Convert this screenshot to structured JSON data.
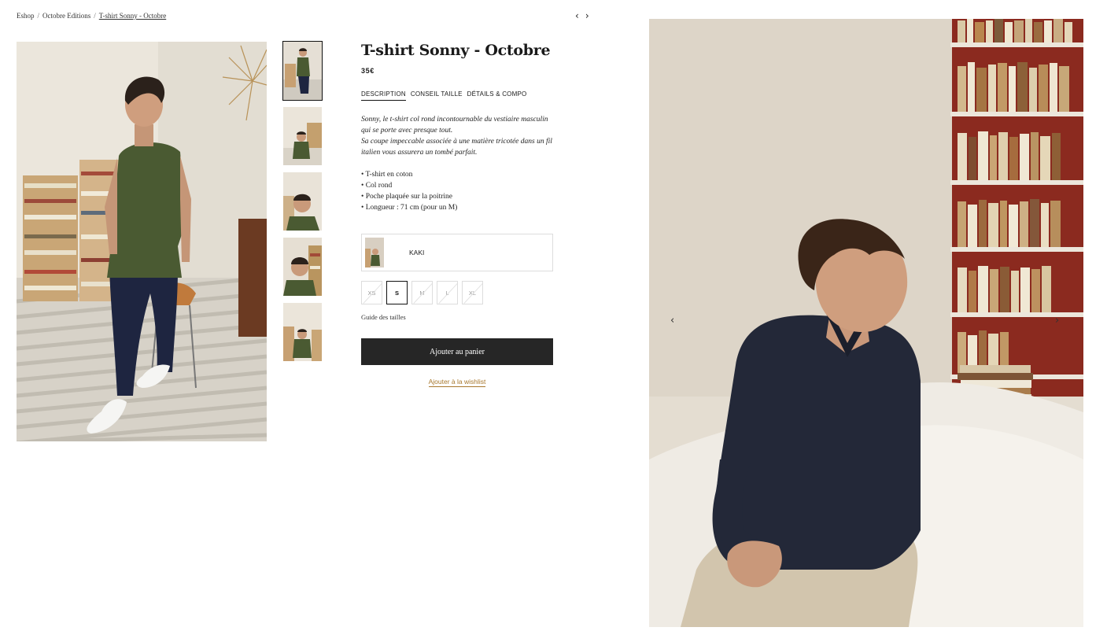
{
  "breadcrumb": {
    "items": [
      "Eshop",
      "Octobre Editions",
      "T-shirt Sonny - Octobre"
    ],
    "separator": "/"
  },
  "pager": {
    "prev": "‹",
    "next": "›"
  },
  "product": {
    "title": "T-shirt Sonny - Octobre",
    "price": "35€",
    "tabs": [
      "DESCRIPTION",
      "CONSEIL TAILLE",
      "DÉTAILS & COMPO"
    ],
    "active_tab": "DESCRIPTION",
    "description_lines": [
      "Sonny, le t-shirt col rond incontournable du vestiaire masculin",
      "qui se porte avec presque tout.",
      "Sa coupe impeccable associée à une matière tricotée dans un fil",
      "italien vous assurera un tombé parfait."
    ],
    "features": [
      "• T-shirt en coton",
      "• Col rond",
      "• Poche plaquée sur la poitrine",
      "• Longueur : 71 cm (pour un M)"
    ],
    "color": "KAKI",
    "sizes": [
      "XS",
      "S",
      "M",
      "L",
      "XL"
    ],
    "selected_size": "S",
    "size_guide": "Guide des tailles",
    "add_to_cart": "Ajouter au panier",
    "add_to_wishlist": "Ajouter à la wishlist"
  },
  "carousel": {
    "prev": "‹",
    "next": "›"
  },
  "colors": {
    "button_bg": "#262626",
    "wishlist_link": "#a8782e",
    "tshirt_khaki": "#4a5a32",
    "pants_navy": "#1e2540",
    "polo_navy": "#232838"
  }
}
